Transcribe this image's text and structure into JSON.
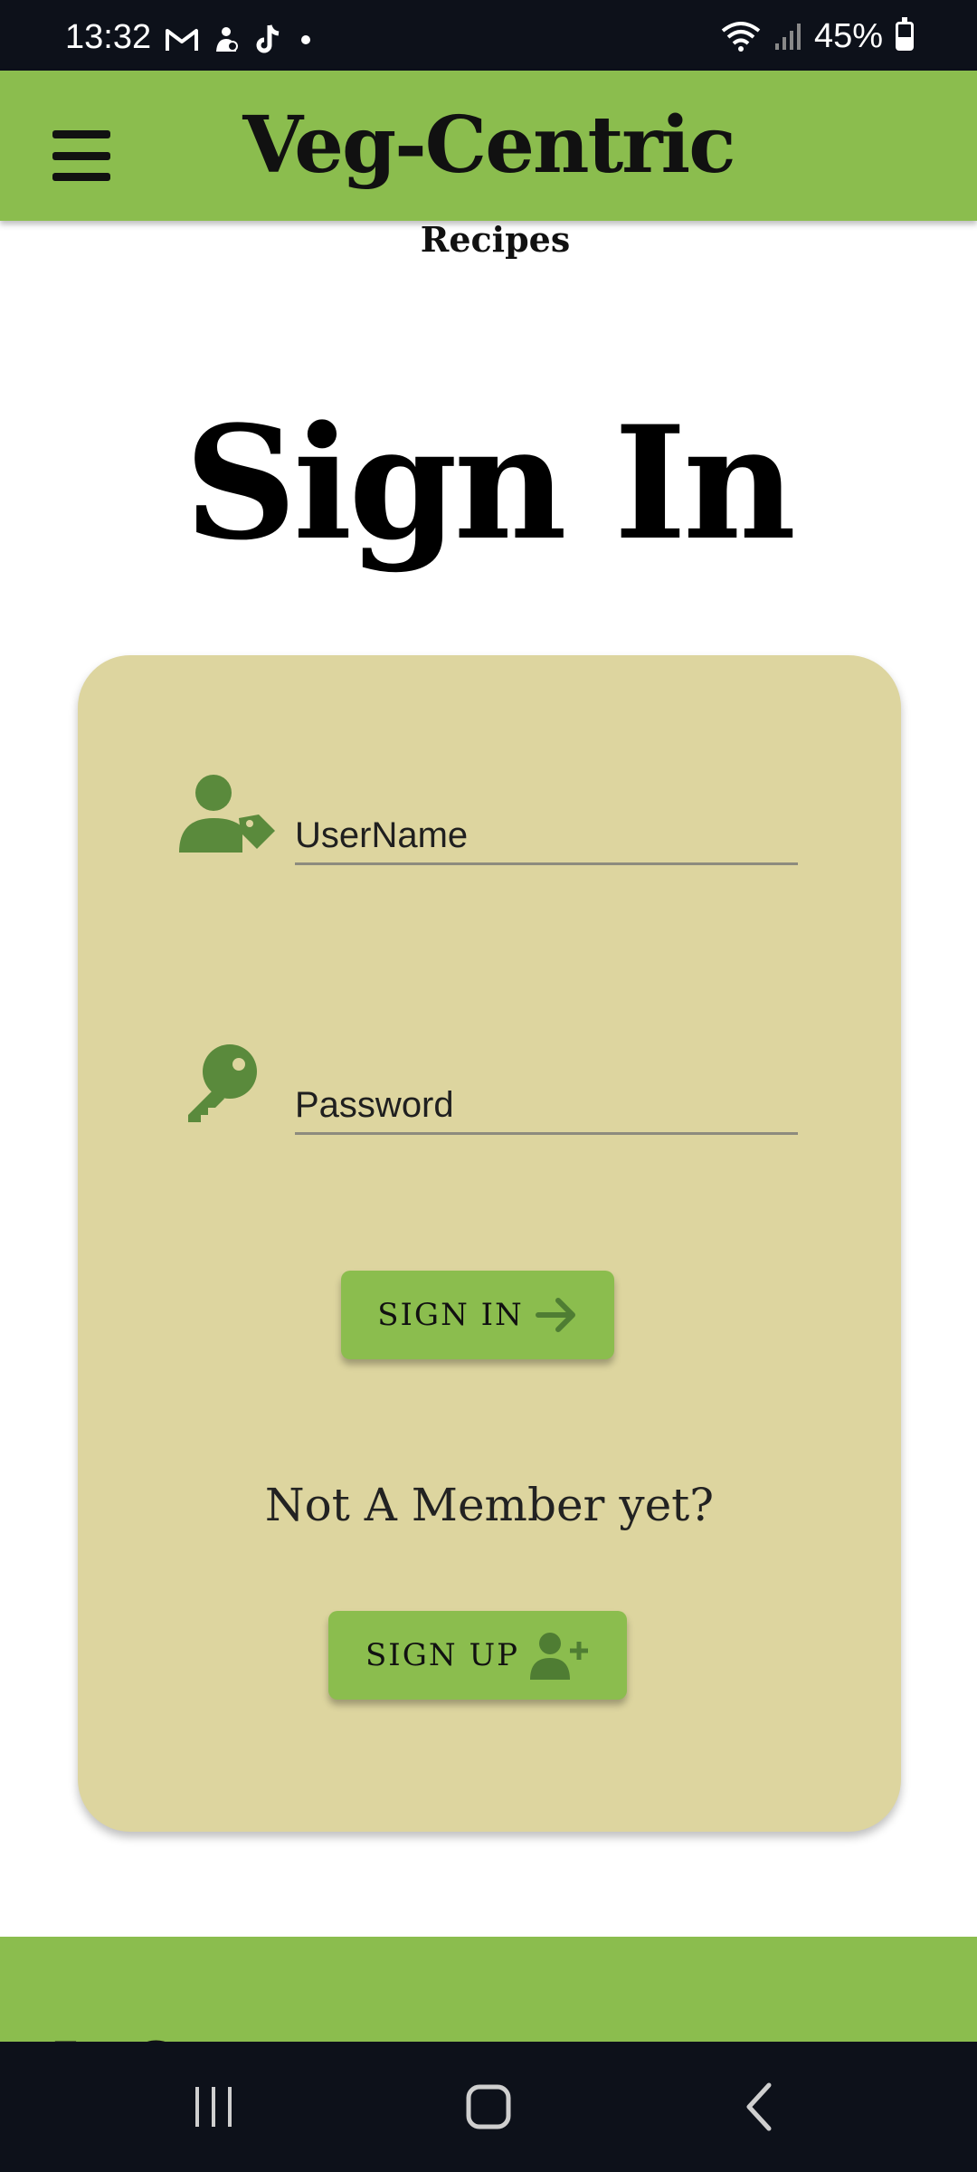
{
  "status_bar": {
    "time": "13:32",
    "battery_percent": "45%",
    "battery_level": 0.45,
    "icons_left": [
      "gmail-icon",
      "notification-icon",
      "tiktok-icon",
      "dot-icon"
    ],
    "icons_right": [
      "wifi-icon",
      "signal-icon",
      "battery-icon"
    ]
  },
  "header": {
    "title": "Veg-Centric",
    "subtitle": "Recipes",
    "menu_icon": "hamburger-menu-icon",
    "background_color": "#8bbd4e"
  },
  "page": {
    "title": "Sign In"
  },
  "form": {
    "card_color": "#ddd59f",
    "username": {
      "placeholder": "UserName",
      "value": "",
      "icon": "user-tag-icon"
    },
    "password": {
      "placeholder": "Password",
      "value": "",
      "icon": "key-icon"
    },
    "signin_button": {
      "label": "SIGN IN",
      "icon": "arrow-right-icon"
    },
    "not_member_text": "Not A Member yet?",
    "signup_button": {
      "label": "SIGN UP",
      "icon": "user-plus-icon"
    },
    "icon_color": "#5a8a3c"
  },
  "footer": {
    "partial_text": "Ja    C"
  },
  "nav_bar": {
    "buttons": [
      "recent-apps-icon",
      "home-icon",
      "back-icon"
    ]
  }
}
